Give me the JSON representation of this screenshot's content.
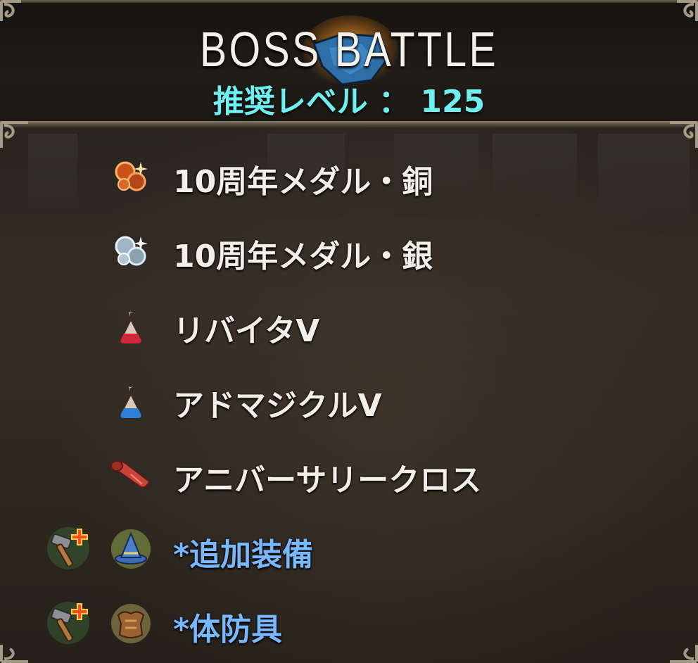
{
  "header": {
    "title": "BOSS  BATTLE",
    "recommended_level_label": "推奨レベル ：",
    "recommended_level_value": "125"
  },
  "rewards": [
    {
      "label": "10周年メダル・銅",
      "icon": "bronze-medal-icon",
      "extra": false
    },
    {
      "label": "10周年メダル・銀",
      "icon": "silver-medal-icon",
      "extra": false
    },
    {
      "label": "リバイタV",
      "icon": "red-potion-icon",
      "extra": false
    },
    {
      "label": "アドマジクルV",
      "icon": "blue-potion-icon",
      "extra": false
    },
    {
      "label": "アニバーサリークロス",
      "icon": "cloth-icon",
      "extra": false
    },
    {
      "label": "*追加装備",
      "icon": "wizard-hat-icon",
      "extra": true,
      "badge": "hammer-plus-icon"
    },
    {
      "label": "*体防具",
      "icon": "body-armor-icon",
      "extra": true,
      "badge": "hammer-plus-icon"
    }
  ],
  "colors": {
    "title": "#f4f1ea",
    "level": "#6ff0f0",
    "item_text": "#f2efe8",
    "extra_text": "#79b7ff",
    "frame": "#9d927f"
  }
}
